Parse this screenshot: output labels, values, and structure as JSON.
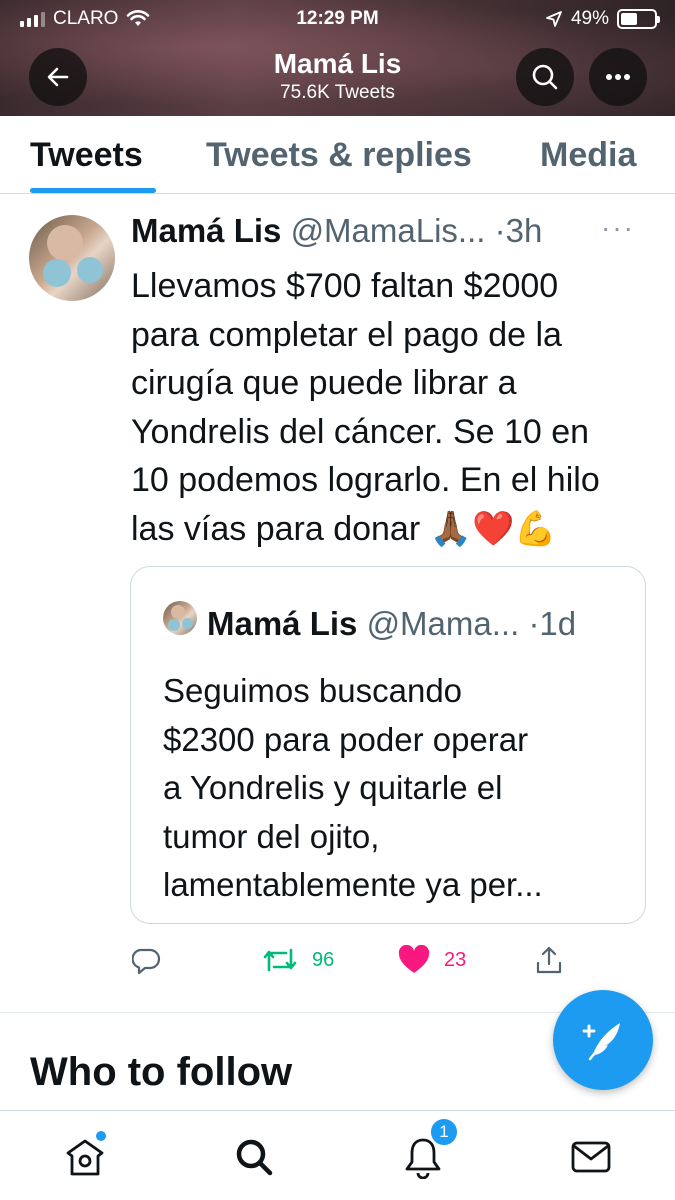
{
  "status_bar": {
    "carrier": "CLARO",
    "time": "12:29 PM",
    "battery_percent": "49%",
    "battery_level": 0.49,
    "icons": [
      "signal-icon",
      "wifi-icon",
      "location-arrow-icon",
      "battery-icon"
    ]
  },
  "header": {
    "name": "Mamá Lis",
    "tweet_count": "75.6K Tweets",
    "icons": [
      "back-arrow-icon",
      "search-icon",
      "more-icon"
    ]
  },
  "tabs": [
    {
      "label": "Tweets",
      "active": true
    },
    {
      "label": "Tweets & replies",
      "active": false
    },
    {
      "label": "Media",
      "active": false
    }
  ],
  "tweet": {
    "name": "Mamá Lis",
    "handle": "@MamaLis...",
    "time": "·3h",
    "more": "···",
    "text": "Llevamos $700 faltan $2000\npara completar el pago de la\ncirugía que puede librar a\nYondrelis del cáncer. Se 10 en\n10 podemos lograrlo. En el hilo\nlas vías para donar 🙏🏾❤️💪",
    "quote": {
      "name": "Mamá Lis",
      "handle": "@Mama...",
      "time": "·1d",
      "text": "Seguimos buscando\n$2300 para poder operar\na Yondrelis y quitarle el\ntumor del ojito,\nlamentablemente ya per..."
    },
    "actions": {
      "reply_icon": "reply-icon",
      "retweet_icon": "retweet-icon",
      "retweets": "96",
      "like_icon": "heart-icon",
      "likes": "23",
      "share_icon": "share-icon"
    }
  },
  "who_to_follow": "Who to follow",
  "fab": {
    "icon": "compose-tweet-icon"
  },
  "bottom_nav": {
    "items": [
      "home-icon",
      "search-icon",
      "notifications-icon",
      "messages-icon"
    ],
    "notification_badge": "1"
  },
  "colors": {
    "accent": "#1d9bf0",
    "retweet": "#00ba7c",
    "like": "#f91880",
    "secondary_text": "#536471"
  }
}
